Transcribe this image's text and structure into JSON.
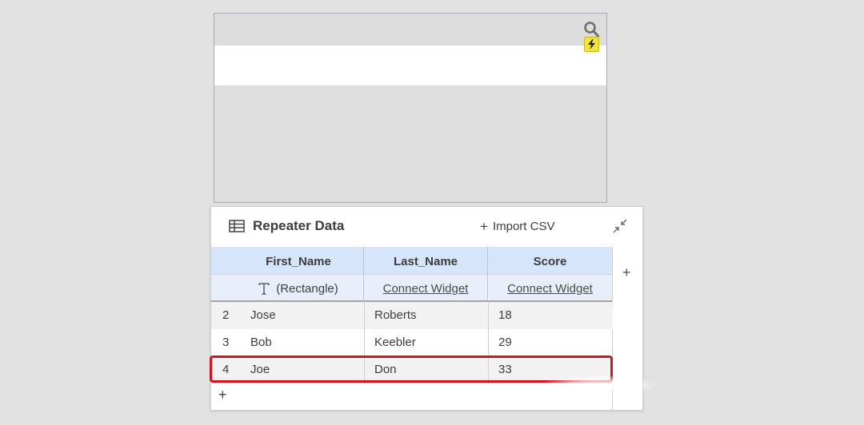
{
  "panel": {
    "title": "Repeater Data",
    "import_label": "Import CSV",
    "add_row_symbol": "+",
    "add_col_symbol": "+"
  },
  "columns": [
    {
      "name": "First_Name",
      "binding": "(Rectangle)",
      "binding_icon": "text-icon"
    },
    {
      "name": "Last_Name",
      "binding": "Connect Widget"
    },
    {
      "name": "Score",
      "binding": "Connect Widget"
    }
  ],
  "rows": [
    {
      "index": "2",
      "first": "Jose",
      "last": "Roberts",
      "score": "18"
    },
    {
      "index": "3",
      "first": "Bob",
      "last": "Keebler",
      "score": "29"
    },
    {
      "index": "4",
      "first": "Joe",
      "last": "Don",
      "score": "33"
    }
  ],
  "colors": {
    "canvas_bg": "#e1e1e1",
    "header_bg": "#d7e5fa",
    "highlight": "#d4141c",
    "badge": "#f2e23a"
  }
}
